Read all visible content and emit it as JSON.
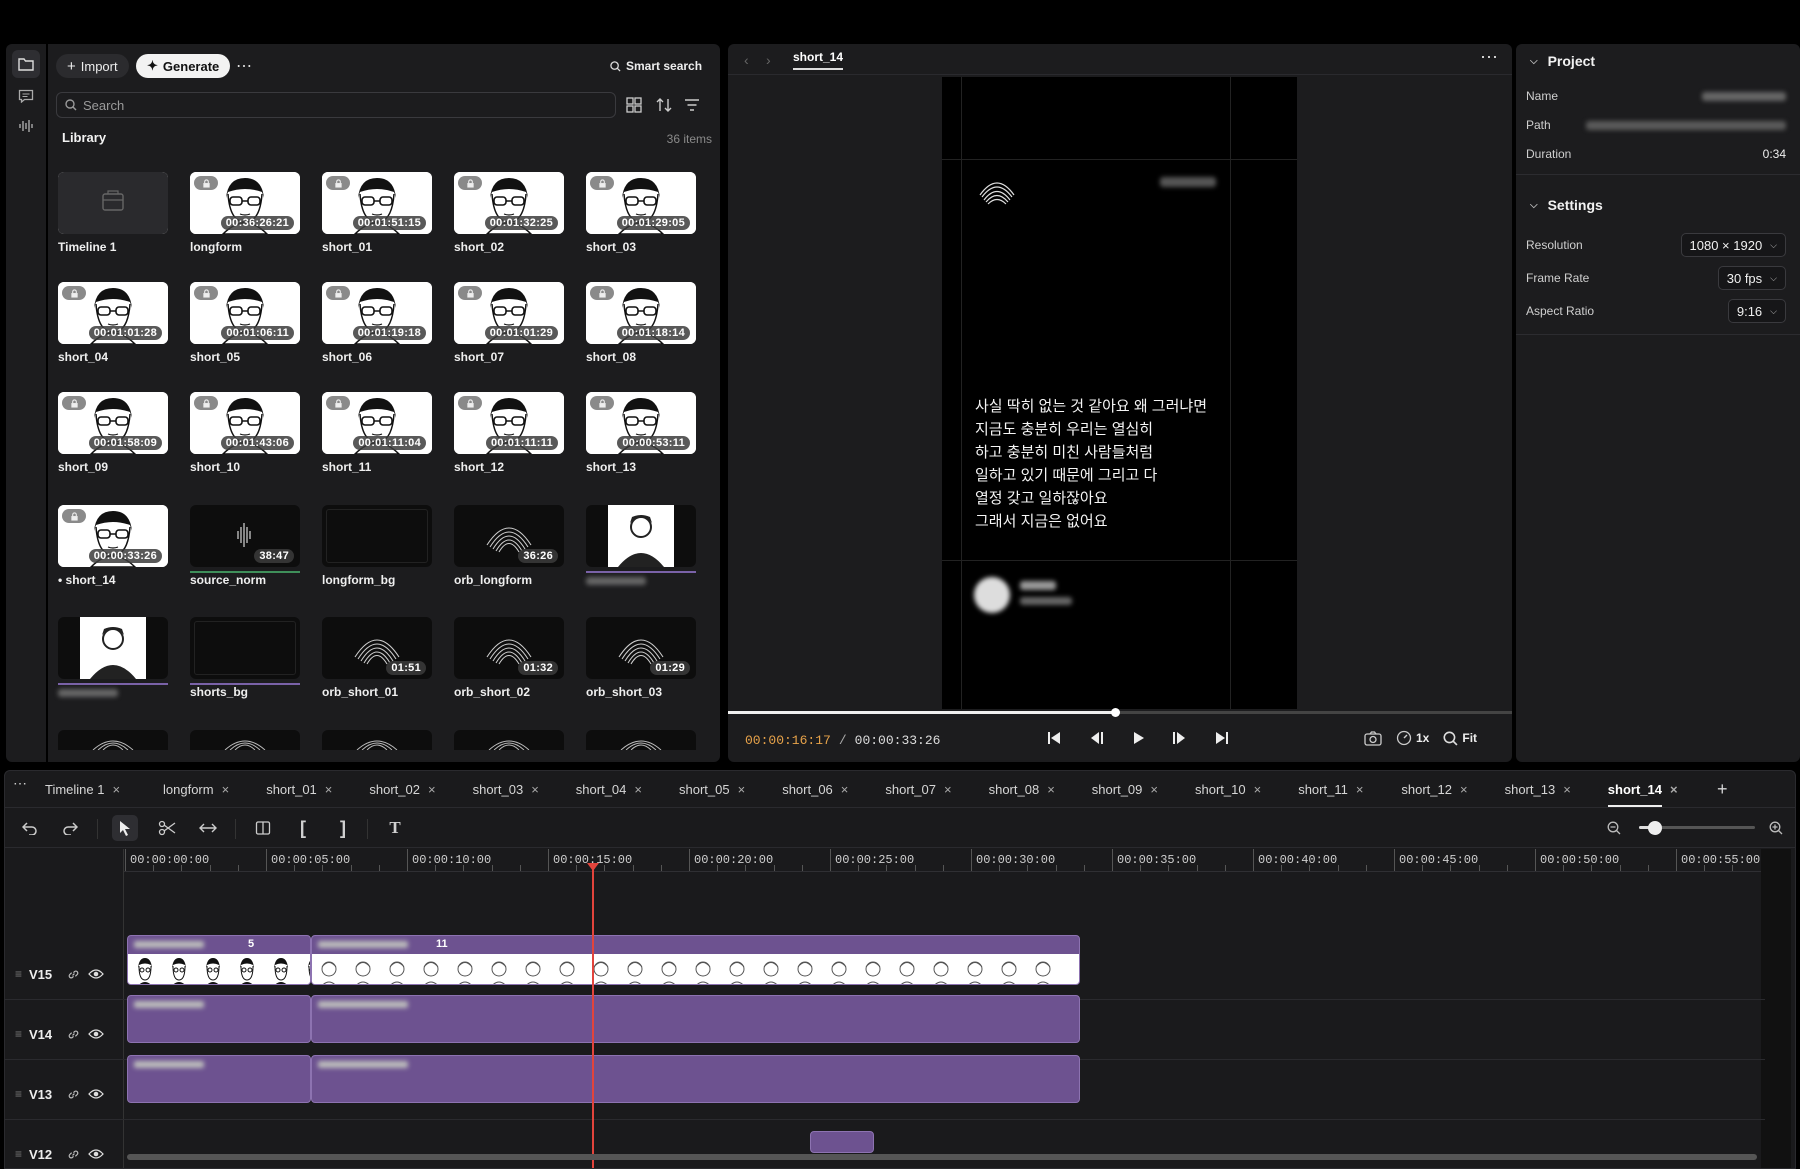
{
  "sidebar": {
    "icons": [
      "folder-icon",
      "chat-icon",
      "waveform-icon"
    ]
  },
  "library": {
    "import_label": "Import",
    "generate_label": "Generate",
    "smart_search_label": "Smart search",
    "search_placeholder": "Search",
    "title": "Library",
    "count": "36 items",
    "tiles": [
      {
        "name": "Timeline 1",
        "dur": "",
        "kind": "timeline"
      },
      {
        "name": "longform",
        "dur": "00:36:26:21",
        "kind": "face"
      },
      {
        "name": "short_01",
        "dur": "00:01:51:15",
        "kind": "face"
      },
      {
        "name": "short_02",
        "dur": "00:01:32:25",
        "kind": "face"
      },
      {
        "name": "short_03",
        "dur": "00:01:29:05",
        "kind": "face"
      },
      {
        "name": "short_04",
        "dur": "00:01:01:28",
        "kind": "face"
      },
      {
        "name": "short_05",
        "dur": "00:01:06:11",
        "kind": "face"
      },
      {
        "name": "short_06",
        "dur": "00:01:19:18",
        "kind": "face"
      },
      {
        "name": "short_07",
        "dur": "00:01:01:29",
        "kind": "face"
      },
      {
        "name": "short_08",
        "dur": "00:01:18:14",
        "kind": "face"
      },
      {
        "name": "short_09",
        "dur": "00:01:58:09",
        "kind": "face"
      },
      {
        "name": "short_10",
        "dur": "00:01:43:06",
        "kind": "face"
      },
      {
        "name": "short_11",
        "dur": "00:01:11:04",
        "kind": "face"
      },
      {
        "name": "short_12",
        "dur": "00:01:11:11",
        "kind": "face"
      },
      {
        "name": "short_13",
        "dur": "00:00:53:11",
        "kind": "face"
      },
      {
        "name": "• short_14",
        "dur": "00:00:33:26",
        "kind": "face"
      },
      {
        "name": "source_norm",
        "dur": "38:47",
        "kind": "audio"
      },
      {
        "name": "longform_bg",
        "dur": "",
        "kind": "dark"
      },
      {
        "name": "orb_longform",
        "dur": "36:26",
        "kind": "orb"
      },
      {
        "name": "",
        "dur": "",
        "kind": "avatar"
      },
      {
        "name": "",
        "dur": "",
        "kind": "avatar"
      },
      {
        "name": "shorts_bg",
        "dur": "",
        "kind": "dark"
      },
      {
        "name": "orb_short_01",
        "dur": "01:51",
        "kind": "orb"
      },
      {
        "name": "orb_short_02",
        "dur": "01:32",
        "kind": "orb"
      },
      {
        "name": "orb_short_03",
        "dur": "01:29",
        "kind": "orb"
      }
    ]
  },
  "viewer": {
    "tab": "short_14",
    "subtitle_lines": [
      "사실 딱히 없는 것 같아요 왜 그러냐면",
      "지금도 충분히 우리는 열심히",
      "하고 충분히 미친 사람들처럼",
      "일하고 있기 때문에 그리고 다",
      "열정 갖고 일하잖아요",
      "그래서 지금은 없어요"
    ],
    "current_time": "00:00:16:17",
    "separator": "/",
    "total_time": "00:00:33:26",
    "progress": 0.493,
    "speed": "1x",
    "fit": "Fit"
  },
  "inspector": {
    "project_title": "Project",
    "name_label": "Name",
    "path_label": "Path",
    "duration_label": "Duration",
    "duration": "0:34",
    "settings_title": "Settings",
    "resolution_label": "Resolution",
    "resolution": "1080 × 1920",
    "frame_rate_label": "Frame Rate",
    "frame_rate": "30 fps",
    "aspect_label": "Aspect Ratio",
    "aspect": "9:16"
  },
  "timeline": {
    "tabs": [
      "Timeline 1",
      "longform",
      "short_01",
      "short_02",
      "short_03",
      "short_04",
      "short_05",
      "short_06",
      "short_07",
      "short_08",
      "short_09",
      "short_10",
      "short_11",
      "short_12",
      "short_13",
      "short_14"
    ],
    "active_tab": "short_14",
    "ruler": [
      "00:00:00:00",
      "00:00:05:00",
      "00:00:10:00",
      "00:00:15:00",
      "00:00:20:00",
      "00:00:25:00",
      "00:00:30:00",
      "00:00:35:00",
      "00:00:40:00",
      "00:00:45:00",
      "00:00:50:00",
      "00:00:55:00"
    ],
    "playhead_seconds": 16.57,
    "tracks": [
      "V15",
      "V14",
      "V13",
      "V12"
    ],
    "clip_numbers": [
      "5",
      "11"
    ],
    "zoom_level": 0.08,
    "colors": {
      "clip": "#6d5290",
      "playhead": "#e2443c",
      "accent_time": "#e8a34a"
    }
  }
}
